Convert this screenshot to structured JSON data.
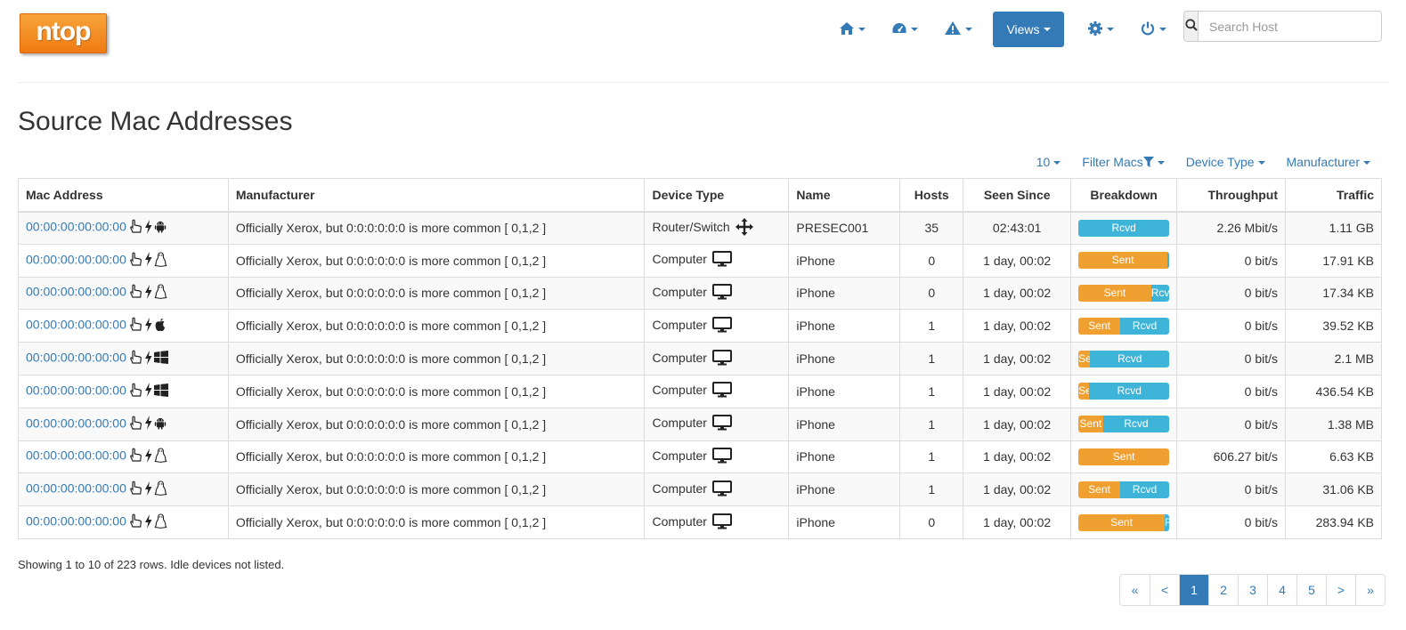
{
  "logo": "ntop",
  "nav": {
    "views_label": "Views",
    "search_placeholder": "Search Host"
  },
  "page_title": "Source Mac Addresses",
  "toolbar": {
    "per_page": "10",
    "filter": "Filter Macs",
    "device_type": "Device Type",
    "manufacturer": "Manufacturer"
  },
  "table": {
    "headers": {
      "mac": "Mac Address",
      "manufacturer": "Manufacturer",
      "device_type": "Device Type",
      "name": "Name",
      "hosts": "Hosts",
      "seen_since": "Seen Since",
      "breakdown": "Breakdown",
      "throughput": "Throughput",
      "traffic": "Traffic"
    },
    "rows": [
      {
        "mac": "00:00:00:00:00:00",
        "os_icon": "android-icon",
        "manufacturer": "Officially Xerox, but 0:0:0:0:0:0 is more common [ 0,1,2 ]",
        "device": "Router/Switch",
        "device_icon": "arrows-move-icon",
        "name": "PRESEC001",
        "hosts": "35",
        "seen": "02:43:01",
        "sent_pct": 0,
        "sent_label": "",
        "rcvd_label": "Rcvd",
        "throughput": "2.26 Mbit/s",
        "traffic": "1.11 GB"
      },
      {
        "mac": "00:00:00:00:00:00",
        "os_icon": "linux-icon",
        "manufacturer": "Officially Xerox, but 0:0:0:0:0:0 is more common [ 0,1,2 ]",
        "device": "Computer",
        "device_icon": "monitor-icon",
        "name": "iPhone",
        "hosts": "0",
        "seen": "1 day, 00:02",
        "sent_pct": 98,
        "sent_label": "Sent",
        "rcvd_label": "",
        "throughput": "0 bit/s",
        "traffic": "17.91 KB"
      },
      {
        "mac": "00:00:00:00:00:00",
        "os_icon": "linux-icon",
        "manufacturer": "Officially Xerox, but 0:0:0:0:0:0 is more common [ 0,1,2 ]",
        "device": "Computer",
        "device_icon": "monitor-icon",
        "name": "iPhone",
        "hosts": "0",
        "seen": "1 day, 00:02",
        "sent_pct": 80,
        "sent_label": "Sent",
        "rcvd_label": "Rcvd",
        "throughput": "0 bit/s",
        "traffic": "17.34 KB"
      },
      {
        "mac": "00:00:00:00:00:00",
        "os_icon": "apple-icon",
        "manufacturer": "Officially Xerox, but 0:0:0:0:0:0 is more common [ 0,1,2 ]",
        "device": "Computer",
        "device_icon": "monitor-icon",
        "name": "iPhone",
        "hosts": "1",
        "seen": "1 day, 00:02",
        "sent_pct": 46,
        "sent_label": "Sent",
        "rcvd_label": "Rcvd",
        "throughput": "0 bit/s",
        "traffic": "39.52 KB"
      },
      {
        "mac": "00:00:00:00:00:00",
        "os_icon": "windows-icon",
        "manufacturer": "Officially Xerox, but 0:0:0:0:0:0 is more common [ 0,1,2 ]",
        "device": "Computer",
        "device_icon": "monitor-icon",
        "name": "iPhone",
        "hosts": "1",
        "seen": "1 day, 00:02",
        "sent_pct": 13,
        "sent_label": "Sent",
        "rcvd_label": "Rcvd",
        "throughput": "0 bit/s",
        "traffic": "2.1 MB"
      },
      {
        "mac": "00:00:00:00:00:00",
        "os_icon": "windows-icon",
        "manufacturer": "Officially Xerox, but 0:0:0:0:0:0 is more common [ 0,1,2 ]",
        "device": "Computer",
        "device_icon": "monitor-icon",
        "name": "iPhone",
        "hosts": "1",
        "seen": "1 day, 00:02",
        "sent_pct": 12,
        "sent_label": "Sent",
        "rcvd_label": "Rcvd",
        "throughput": "0 bit/s",
        "traffic": "436.54 KB"
      },
      {
        "mac": "00:00:00:00:00:00",
        "os_icon": "android-icon",
        "manufacturer": "Officially Xerox, but 0:0:0:0:0:0 is more common [ 0,1,2 ]",
        "device": "Computer",
        "device_icon": "monitor-icon",
        "name": "iPhone",
        "hosts": "1",
        "seen": "1 day, 00:02",
        "sent_pct": 27,
        "sent_label": "Sent",
        "rcvd_label": "Rcvd",
        "throughput": "0 bit/s",
        "traffic": "1.38 MB"
      },
      {
        "mac": "00:00:00:00:00:00",
        "os_icon": "linux-icon",
        "manufacturer": "Officially Xerox, but 0:0:0:0:0:0 is more common [ 0,1,2 ]",
        "device": "Computer",
        "device_icon": "monitor-icon",
        "name": "iPhone",
        "hosts": "1",
        "seen": "1 day, 00:02",
        "sent_pct": 100,
        "sent_label": "Sent",
        "rcvd_label": "",
        "throughput": "606.27 bit/s",
        "traffic": "6.63 KB"
      },
      {
        "mac": "00:00:00:00:00:00",
        "os_icon": "linux-icon",
        "manufacturer": "Officially Xerox, but 0:0:0:0:0:0 is more common [ 0,1,2 ]",
        "device": "Computer",
        "device_icon": "monitor-icon",
        "name": "iPhone",
        "hosts": "1",
        "seen": "1 day, 00:02",
        "sent_pct": 46,
        "sent_label": "Sent",
        "rcvd_label": "Rcvd",
        "throughput": "0 bit/s",
        "traffic": "31.06 KB"
      },
      {
        "mac": "00:00:00:00:00:00",
        "os_icon": "linux-icon",
        "manufacturer": "Officially Xerox, but 0:0:0:0:0:0 is more common [ 0,1,2 ]",
        "device": "Computer",
        "device_icon": "monitor-icon",
        "name": "iPhone",
        "hosts": "0",
        "seen": "1 day, 00:02",
        "sent_pct": 95,
        "sent_label": "Sent",
        "rcvd_label": "R",
        "throughput": "0 bit/s",
        "traffic": "283.94 KB"
      }
    ]
  },
  "footer_text": "Showing 1 to 10 of 223 rows. Idle devices not listed.",
  "pagination": [
    "«",
    "<",
    "1",
    "2",
    "3",
    "4",
    "5",
    ">",
    "»"
  ],
  "pagination_active": "1",
  "colors": {
    "accent": "#337ab7",
    "sent": "#f0a030",
    "rcvd": "#3eb5d8",
    "logo": "#f28c1e"
  }
}
